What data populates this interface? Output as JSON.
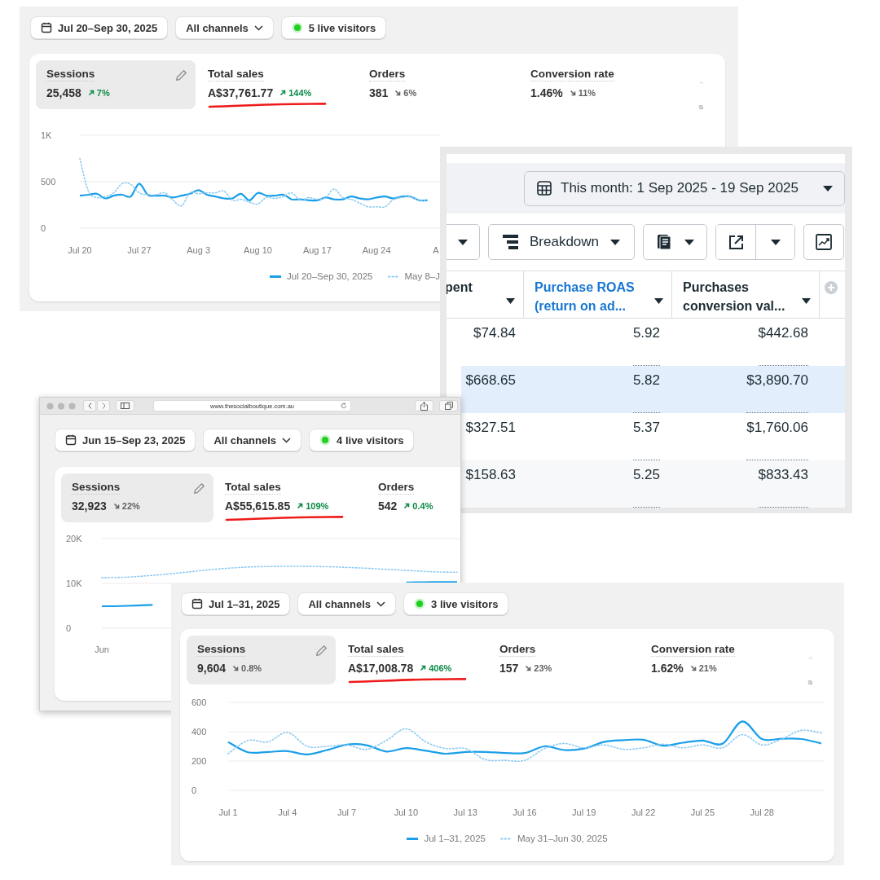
{
  "top_dashboard": {
    "date_range": "Jul 20–Sep 30, 2025",
    "channel_filter": "All channels",
    "live_visitors": "5 live visitors",
    "metrics": [
      {
        "label": "Sessions",
        "value": "25,458",
        "change": "7%",
        "rising": true,
        "selected": true,
        "underlined": false
      },
      {
        "label": "Total sales",
        "value": "A$37,761.77",
        "change": "144%",
        "rising": true,
        "selected": false,
        "underlined": true
      },
      {
        "label": "Orders",
        "value": "381",
        "change": "6%",
        "rising": false,
        "selected": false,
        "underlined": false
      },
      {
        "label": "Conversion rate",
        "value": "1.46%",
        "change": "11%",
        "rising": false,
        "selected": false,
        "underlined": false
      }
    ],
    "chart_data": {
      "type": "line",
      "legend": "bottom",
      "ylim": [
        0,
        1000
      ],
      "categories": [
        "Jul 20",
        null,
        null,
        null,
        null,
        null,
        null,
        "Jul 27",
        null,
        null,
        null,
        null,
        null,
        null,
        "Aug 3",
        null,
        null,
        null,
        null,
        null,
        null,
        "Aug 10",
        null,
        null,
        null,
        null,
        null,
        null,
        "Aug 17",
        null,
        null,
        null,
        null,
        null,
        null,
        "Aug 24",
        null,
        null,
        null,
        null,
        null,
        null,
        "A"
      ],
      "yticks": [
        0,
        500,
        {
          "value": 1000,
          "label": "1K"
        }
      ],
      "series": [
        {
          "name": "Jul 20–Sep 30, 2025",
          "color": "#1a9fe8",
          "line_style": "solid",
          "values": [
            350,
            360,
            370,
            320,
            350,
            360,
            340,
            480,
            360,
            350,
            350,
            330,
            350,
            370,
            410,
            360,
            340,
            320,
            320,
            370,
            300,
            380,
            350,
            350,
            360,
            310,
            310,
            300,
            300,
            330,
            310,
            310,
            340,
            320,
            310,
            330,
            340,
            320,
            340,
            340,
            300,
            300,
            null
          ]
        },
        {
          "name": "May 8–J",
          "color": "#8ccaf2",
          "line_style": "dotted",
          "values": [
            750,
            400,
            330,
            340,
            380,
            480,
            470,
            380,
            360,
            360,
            380,
            300,
            240,
            380,
            370,
            380,
            380,
            400,
            300,
            310,
            280,
            260,
            330,
            320,
            340,
            380,
            300,
            330,
            310,
            330,
            420,
            330,
            310,
            270,
            230,
            230,
            230,
            310,
            330,
            340,
            300,
            300,
            null
          ]
        }
      ]
    }
  },
  "ads_report": {
    "date_range": "This month: 1 Sep 2025 - 19 Sep 2025",
    "breakdown": "Breakdown",
    "columns": [
      {
        "label": "pent",
        "selected": false,
        "underlined": false
      },
      {
        "label": "Purchase ROAS (return on ad...",
        "selected": true,
        "underlined": true
      },
      {
        "label": "Purchases conversion val...",
        "selected": false,
        "underlined": true
      }
    ],
    "rows": [
      {
        "cells": [
          "$74.84",
          "5.92",
          "$442.68"
        ],
        "selected": false
      },
      {
        "cells": [
          "$668.65",
          "5.82",
          "$3,890.70"
        ],
        "selected": true
      },
      {
        "cells": [
          "$327.51",
          "5.37",
          "$1,760.06"
        ],
        "selected": false
      },
      {
        "cells": [
          "$158.63",
          "5.25",
          "$833.43"
        ],
        "selected": false
      }
    ]
  },
  "browser_window": {
    "url": "www.thesocialboutique.com.au",
    "dashboard": {
      "date_range": "Jun 15–Sep 23, 2025",
      "channel_filter": "All channels",
      "live_visitors": "4 live visitors",
      "metrics": [
        {
          "label": "Sessions",
          "value": "32,923",
          "change": "22%",
          "rising": false,
          "selected": true,
          "underlined": false
        },
        {
          "label": "Total sales",
          "value": "A$55,615.85",
          "change": "109%",
          "rising": true,
          "selected": false,
          "underlined": true
        },
        {
          "label": "Orders",
          "value": "542",
          "change": "0.4%",
          "rising": true,
          "selected": false,
          "underlined": false
        }
      ],
      "chart_data": {
        "type": "line",
        "ylim": [
          0,
          20000
        ],
        "categories": [
          "Jun",
          null,
          null,
          null,
          null,
          null,
          null,
          null,
          null,
          null,
          null,
          null,
          null,
          null,
          null
        ],
        "yticks": [
          0,
          {
            "value": 10000,
            "label": "10K"
          },
          {
            "value": 20000,
            "label": "20K"
          }
        ],
        "series": [
          {
            "color": "#1a9fe8",
            "line_style": "solid",
            "values": [
              4900,
              5000,
              5200,
              null,
              null,
              null,
              null,
              null,
              null,
              null,
              null,
              null,
              10200,
              10300,
              10300
            ]
          },
          {
            "color": "#8ccaf2",
            "line_style": "dotted",
            "values": [
              11300,
              11400,
              11800,
              12300,
              12900,
              13400,
              13700,
              13800,
              13800,
              13700,
              13500,
              13200,
              12900,
              12600,
              12500
            ]
          }
        ]
      }
    }
  },
  "bottom_dashboard": {
    "date_range": "Jul 1–31, 2025",
    "channel_filter": "All channels",
    "live_visitors": "3 live visitors",
    "metrics": [
      {
        "label": "Sessions",
        "value": "9,604",
        "change": "0.8%",
        "rising": false,
        "selected": true,
        "underlined": false
      },
      {
        "label": "Total sales",
        "value": "A$17,008.78",
        "change": "406%",
        "rising": true,
        "selected": false,
        "underlined": true
      },
      {
        "label": "Orders",
        "value": "157",
        "change": "23%",
        "rising": false,
        "selected": false,
        "underlined": false
      },
      {
        "label": "Conversion rate",
        "value": "1.62%",
        "change": "21%",
        "rising": false,
        "selected": false,
        "underlined": false
      }
    ],
    "chart_data": {
      "type": "line",
      "legend": "bottom",
      "ylim": [
        0,
        600
      ],
      "categories": [
        "Jul 1",
        null,
        null,
        "Jul 4",
        null,
        null,
        "Jul 7",
        null,
        null,
        "Jul 10",
        null,
        null,
        "Jul 13",
        null,
        null,
        "Jul 16",
        null,
        null,
        "Jul 19",
        null,
        null,
        "Jul 22",
        null,
        null,
        "Jul 25",
        null,
        null,
        "Jul 28",
        null,
        null,
        null
      ],
      "yticks": [
        0,
        200,
        400,
        600
      ],
      "series": [
        {
          "name": "Jul 1–31, 2025",
          "color": "#1a9fe8",
          "line_style": "solid",
          "values": [
            330,
            260,
            262,
            268,
            245,
            275,
            312,
            308,
            265,
            288,
            270,
            250,
            262,
            262,
            255,
            255,
            300,
            275,
            285,
            330,
            342,
            345,
            305,
            325,
            340,
            318,
            470,
            350,
            352,
            350,
            320
          ]
        },
        {
          "name": "May 31–Jun 30, 2025",
          "color": "#8ccaf2",
          "line_style": "dotted",
          "values": [
            250,
            340,
            330,
            395,
            300,
            300,
            310,
            280,
            340,
            420,
            330,
            285,
            285,
            210,
            205,
            205,
            285,
            320,
            290,
            310,
            280,
            290,
            315,
            290,
            310,
            290,
            380,
            310,
            350,
            410,
            390
          ]
        }
      ]
    }
  }
}
